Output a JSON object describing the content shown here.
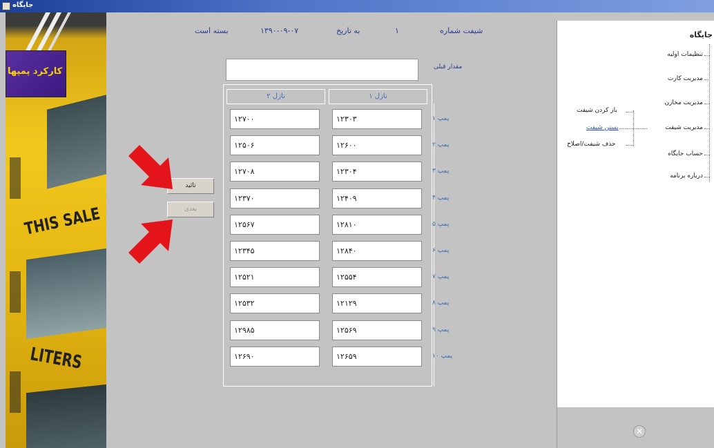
{
  "window": {
    "title": "جایگاه"
  },
  "header": {
    "shift_label": "شیفت شماره",
    "shift_number": "۱",
    "date_label": "به تاریخ",
    "date_value": "۱۳۹۰-۰۹-۰۷",
    "status": "بسته است"
  },
  "comment": {
    "label": "مقدار قبلی",
    "value": ""
  },
  "columns": {
    "nozzle2": "نازل ۲",
    "nozzle1": "نازل ۱"
  },
  "rows": [
    {
      "label": "پمپ ۱",
      "nozzle1": "۱۲۳۰۳",
      "nozzle2": "۱۲۷۰۰"
    },
    {
      "label": "پمپ ۲",
      "nozzle1": "۱۲۶۰۰",
      "nozzle2": "۱۲۵۰۶"
    },
    {
      "label": "پمپ ۳",
      "nozzle1": "۱۲۳۰۴",
      "nozzle2": "۱۲۷۰۸"
    },
    {
      "label": "پمپ ۴",
      "nozzle1": "۱۲۴۰۹",
      "nozzle2": "۱۲۳۷۰"
    },
    {
      "label": "پمپ ۵",
      "nozzle1": "۱۲۸۱۰",
      "nozzle2": "۱۲۵۶۷"
    },
    {
      "label": "پمپ ۶",
      "nozzle1": "۱۲۸۴۰",
      "nozzle2": "۱۲۳۴۵"
    },
    {
      "label": "پمپ ۷",
      "nozzle1": "۱۲۵۵۴",
      "nozzle2": "۱۲۵۲۱"
    },
    {
      "label": "پمپ ۸",
      "nozzle1": "۱۲۱۲۹",
      "nozzle2": "۱۲۵۳۲"
    },
    {
      "label": "پمپ ۹",
      "nozzle1": "۱۲۵۶۹",
      "nozzle2": "۱۲۹۸۵"
    },
    {
      "label": "پمپ ۱۰",
      "nozzle1": "۱۲۶۵۹",
      "nozzle2": "۱۲۶۹۰"
    }
  ],
  "buttons": {
    "confirm": "تائید",
    "cancel": "بعدی"
  },
  "photo": {
    "badge": "کارکرد پمپها",
    "sign1": "THIS SALE",
    "sign2": "LITERS"
  },
  "sidebar": {
    "title": "جایگاه",
    "items": [
      {
        "label": "تنظیمات اولیه"
      },
      {
        "label": "مدیریت کارت"
      },
      {
        "label": "مدیریت مخازن"
      },
      {
        "label": "مدیریت شیفت"
      },
      {
        "label": "حساب جایگاه"
      },
      {
        "label": "درباره برنامه"
      }
    ],
    "shift_children": [
      {
        "label": "باز کردن شیفت"
      },
      {
        "label": "بستن شیفت"
      },
      {
        "label": "حذف شیفت/اصلاح"
      }
    ]
  }
}
